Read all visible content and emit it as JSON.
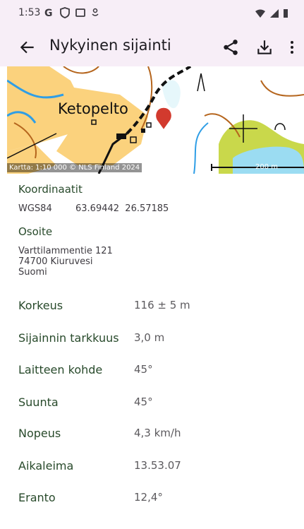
{
  "status": {
    "time": "1:53",
    "icons": [
      "google-icon",
      "shield-icon",
      "square-icon",
      "cast-icon"
    ],
    "right_icons": [
      "wifi-icon",
      "signal-icon",
      "battery-icon"
    ]
  },
  "appbar": {
    "title": "Nykyinen sijainti",
    "actions": [
      "share-icon",
      "download-icon",
      "more-vert-icon"
    ]
  },
  "map": {
    "place_label": "Ketopelto",
    "credit": "Kartta: 1:10 000 © NLS Finland 2024",
    "scale": "200 m"
  },
  "coords": {
    "heading": "Koordinaatit",
    "system": "WGS84",
    "value": "63.69442  26.57185"
  },
  "address": {
    "heading": "Osoite",
    "lines": [
      "Varttilammentie 121",
      "74700 Kiuruvesi",
      "Suomi"
    ]
  },
  "details": [
    {
      "label": "Korkeus",
      "value": "116 ± 5 m"
    },
    {
      "label": "Sijainnin tarkkuus",
      "value": "3,0 m"
    },
    {
      "label": "Laitteen kohde",
      "value": "45°"
    },
    {
      "label": "Suunta",
      "value": "45°"
    },
    {
      "label": "Nopeus",
      "value": "4,3 km/h"
    },
    {
      "label": "Aikaleima",
      "value": "13.53.07"
    },
    {
      "label": "Eranto",
      "value": "12,4°"
    }
  ]
}
